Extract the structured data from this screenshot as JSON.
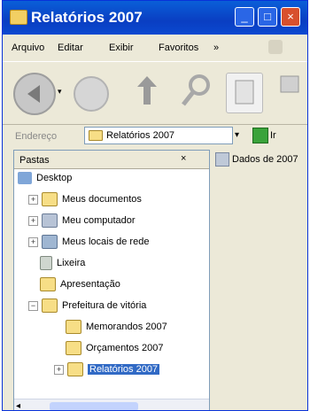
{
  "window": {
    "title": "Relatórios 2007"
  },
  "menu": {
    "items": [
      "Arquivo",
      "Editar",
      "Exibir",
      "Favoritos",
      "»"
    ]
  },
  "address": {
    "label": "Endereço",
    "value": "Relatórios 2007",
    "go": "Ir"
  },
  "folders_pane": {
    "title": "Pastas",
    "close": "×"
  },
  "right_pane": {
    "item": "Dados de 2007"
  },
  "tree": [
    {
      "label": "Desktop",
      "expander": ""
    },
    {
      "label": "Meus documentos",
      "expander": "+"
    },
    {
      "label": "Meu computador",
      "expander": "+"
    },
    {
      "label": "Meus locais de rede",
      "expander": "+"
    },
    {
      "label": "Lixeira",
      "expander": ""
    },
    {
      "label": "Apresentação",
      "expander": ""
    },
    {
      "label": "Prefeitura de vitória",
      "expander": "−"
    },
    {
      "label": "Memorandos 2007",
      "expander": ""
    },
    {
      "label": "Orçamentos 2007",
      "expander": ""
    },
    {
      "label": "Relatórios 2007",
      "expander": "+"
    }
  ],
  "colors": {
    "titlebar": "#0a4bd0",
    "selection": "#316ac5",
    "folder": "#f7de86"
  }
}
